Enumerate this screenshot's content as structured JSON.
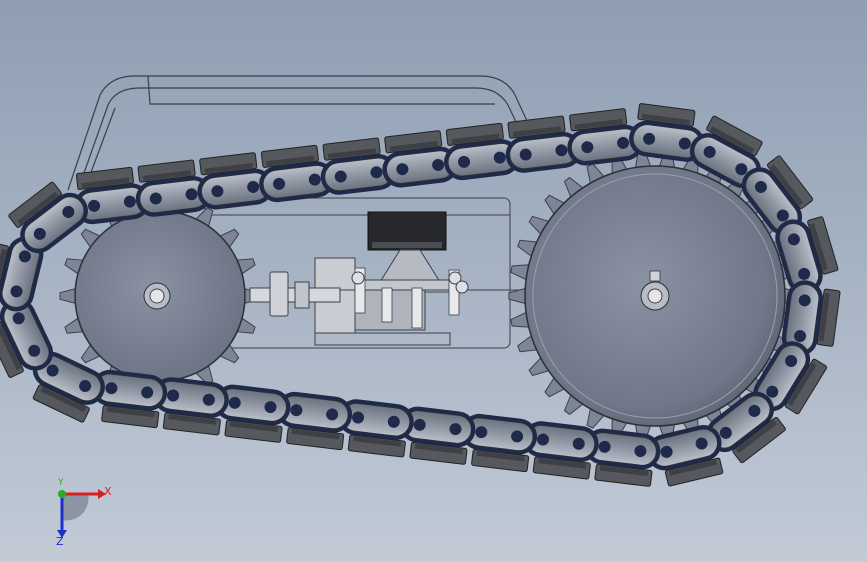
{
  "viewport": {
    "background_top": "#8f9eb3",
    "background_bottom": "#c2cad6"
  },
  "model": {
    "chain_color": "#1f2a4a",
    "pad_color": "#55585d",
    "sprocket_color": "#7f8797",
    "body_outline_color": "#3b3f46"
  },
  "triad": {
    "x_label": "X",
    "y_label": "Y",
    "z_label": "Z",
    "x_color": "#d42020",
    "y_color": "#20b020",
    "z_color": "#2030c8"
  }
}
